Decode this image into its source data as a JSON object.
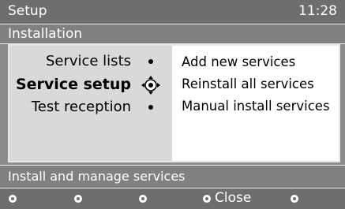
{
  "header": {
    "title": "Setup",
    "clock": "11:28"
  },
  "subheader": {
    "title": "Installation"
  },
  "menu": {
    "items": [
      {
        "label": "Service lists"
      },
      {
        "label": "Service setup"
      },
      {
        "label": "Test reception"
      }
    ],
    "selected_index": 1,
    "submenu": [
      {
        "label": "Add new services"
      },
      {
        "label": "Reinstall all services"
      },
      {
        "label": "Manual install services"
      }
    ]
  },
  "status": {
    "text": "Install and manage services"
  },
  "buttons": {
    "close_label": "Close"
  },
  "colors": {
    "header_bg": "#6e6e6e",
    "bar_bg": "#808080",
    "left_panel": "#d9d9d9",
    "panel_bg": "#ffffff"
  }
}
